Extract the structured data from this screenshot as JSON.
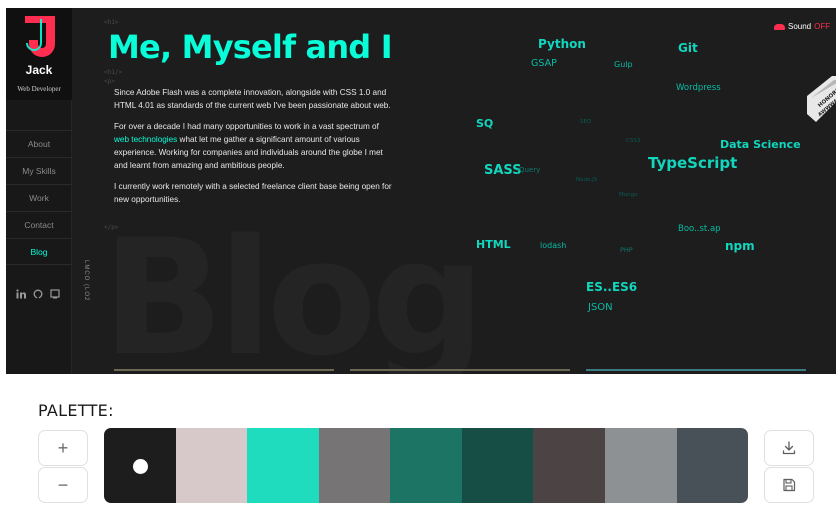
{
  "site": {
    "logo": {
      "letter": "J",
      "name": "Jack",
      "role": "Web Developer",
      "accent": "#ff2d4f",
      "letter_color": "#08fdd8"
    },
    "nav": [
      "About",
      "My Skills",
      "Work",
      "Contact",
      "Blog"
    ],
    "active_nav": "Blog",
    "social_icons": [
      "linkedin-icon",
      "github-icon",
      "monitor-icon"
    ],
    "vertical_label": "LMCO (LO2",
    "background_word": "Blog",
    "tags": [
      "<h1>",
      "<h1/>",
      "<p>",
      "</p>"
    ],
    "headline": "Me, Myself and I",
    "intro": {
      "p1": "Since Adobe Flash was a complete innovation, alongside with CSS 1.0 and HTML 4.01 as standards of the current web I've been passionate about web.",
      "p2_before": "For over a decade I had many opportunities to work in a vast spectrum of ",
      "p2_link": "web technologies",
      "p2_after": " what let me gather a significant amount of various experience. Working for companies and individuals around the globe I met and learnt from amazing and ambitious people.",
      "p3": "I currently work remotely with a selected freelance client base being open for new opportunities."
    },
    "skills": {
      "python": "Python",
      "git": "Git",
      "gsap": "GSAP",
      "gulp": "Gulp",
      "wordpress": "Wordpress",
      "sq": "SQ",
      "data_science": "Data Science",
      "typescript": "TypeScript",
      "sass": "SASS",
      "jquery": "jQuery",
      "html": "HTML",
      "lodash": "lodash",
      "php": "PHP",
      "bootstrap": "Boo..st.ap",
      "npm": "npm",
      "es": "ES..ES6",
      "json": "JSON",
      "faint1": "SEO",
      "faint2": "CSS3",
      "faint3": "Node.JS",
      "faint4": "Mongo"
    },
    "sound": {
      "label": "Sound",
      "state": "OFF"
    },
    "badge": {
      "line1": "HONORS",
      "line2": "AWWWARDS"
    },
    "accent": "#08fdd8"
  },
  "palette": {
    "title": "PALETTE:",
    "add_label": "+",
    "remove_label": "−",
    "download_icon": "download-icon",
    "save_icon": "save-icon",
    "colors": [
      "#1d1d1d",
      "#d7c9c9",
      "#1fdcbf",
      "#767474",
      "#1c7564",
      "#164e45",
      "#4c4444",
      "#8e9194",
      "#495158"
    ],
    "selected_index": 0
  }
}
